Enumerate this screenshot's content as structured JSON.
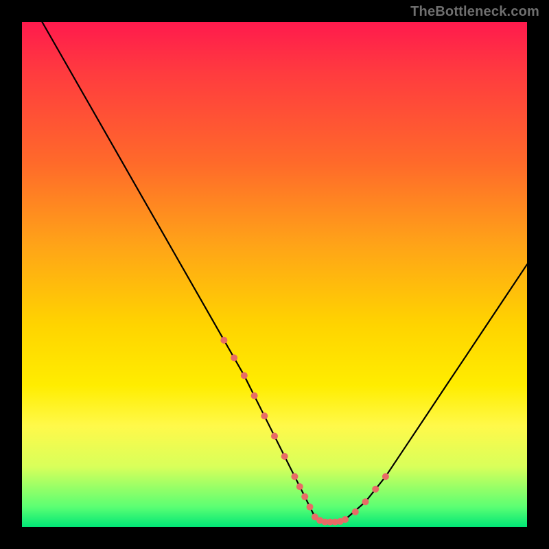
{
  "watermark": "TheBottleneck.com",
  "colors": {
    "background": "#000000",
    "curve": "#000000",
    "marker": "#e86b66",
    "gradient_stops": [
      "#ff1a4d",
      "#ff3b3f",
      "#ff6a2a",
      "#ffa318",
      "#ffd400",
      "#ffed00",
      "#fff94a",
      "#d9ff5a",
      "#5bff73",
      "#00e676"
    ]
  },
  "chart_data": {
    "type": "line",
    "title": "",
    "xlabel": "",
    "ylabel": "",
    "xlim": [
      0,
      100
    ],
    "ylim": [
      0,
      100
    ],
    "series": [
      {
        "name": "bottleneck-curve",
        "x": [
          4,
          8,
          12,
          16,
          20,
          24,
          28,
          32,
          36,
          40,
          44,
          47,
          50,
          53,
          56,
          57,
          58,
          60,
          62,
          64,
          68,
          72,
          76,
          80,
          84,
          88,
          92,
          96,
          100
        ],
        "values": [
          100,
          93,
          86,
          79,
          72,
          65,
          58,
          51,
          44,
          37,
          30,
          24,
          18,
          12,
          6,
          4,
          2,
          1,
          1,
          1.5,
          5,
          10,
          16,
          22,
          28,
          34,
          40,
          46,
          52
        ]
      }
    ],
    "markers": {
      "name": "highlight-dots",
      "x": [
        40,
        42,
        44,
        46,
        48,
        50,
        52,
        54,
        55,
        56,
        57,
        58,
        59,
        60,
        61,
        62,
        63,
        64,
        66,
        68,
        70,
        72
      ],
      "values": [
        37,
        33.5,
        30,
        26,
        22,
        18,
        14,
        10,
        8,
        6,
        4,
        2,
        1.3,
        1,
        1,
        1,
        1.1,
        1.5,
        3,
        5,
        7.5,
        10
      ]
    }
  }
}
